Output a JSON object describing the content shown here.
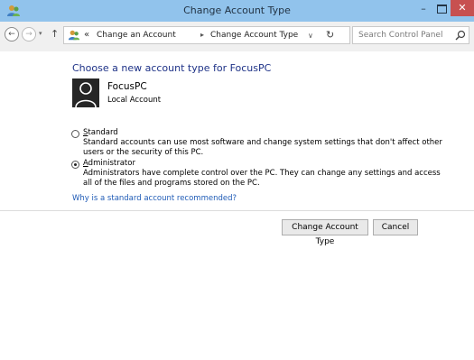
{
  "window": {
    "title": "Change Account Type",
    "minimize_glyph": "–",
    "close_glyph": "✕"
  },
  "nav": {
    "back_glyph": "←",
    "forward_glyph": "→",
    "dropdown_glyph": "▾",
    "up_glyph": "↑",
    "address_chevron": "«",
    "breadcrumbs": [
      "Change an Account",
      "Change Account Type"
    ],
    "breadcrumb_separator": "▸",
    "address_dropdown_glyph": "∨",
    "refresh_glyph": "↻",
    "search_placeholder": "Search Control Panel"
  },
  "main": {
    "heading": "Choose a new account type for FocusPC",
    "account": {
      "name": "FocusPC",
      "type": "Local Account"
    },
    "options": [
      {
        "access_key": "S",
        "label_rest": "tandard",
        "description": "Standard accounts can use most software and change system settings that don't affect other users or the security of this PC.",
        "selected": false
      },
      {
        "access_key": "A",
        "label_rest": "dministrator",
        "description": "Administrators have complete control over the PC. They can change any settings and access all of the files and programs stored on the PC.",
        "selected": true
      }
    ],
    "help_link": "Why is a standard account recommended?",
    "buttons": {
      "change": "Change Account Type",
      "cancel": "Cancel"
    }
  },
  "colors": {
    "titlebar": "#91c3ec",
    "close_button": "#c75050",
    "heading": "#1e3287",
    "link": "#1f5bb6"
  },
  "icons": {
    "app": "user-accounts-icon",
    "address": "user-accounts-icon",
    "search": "search-icon"
  }
}
